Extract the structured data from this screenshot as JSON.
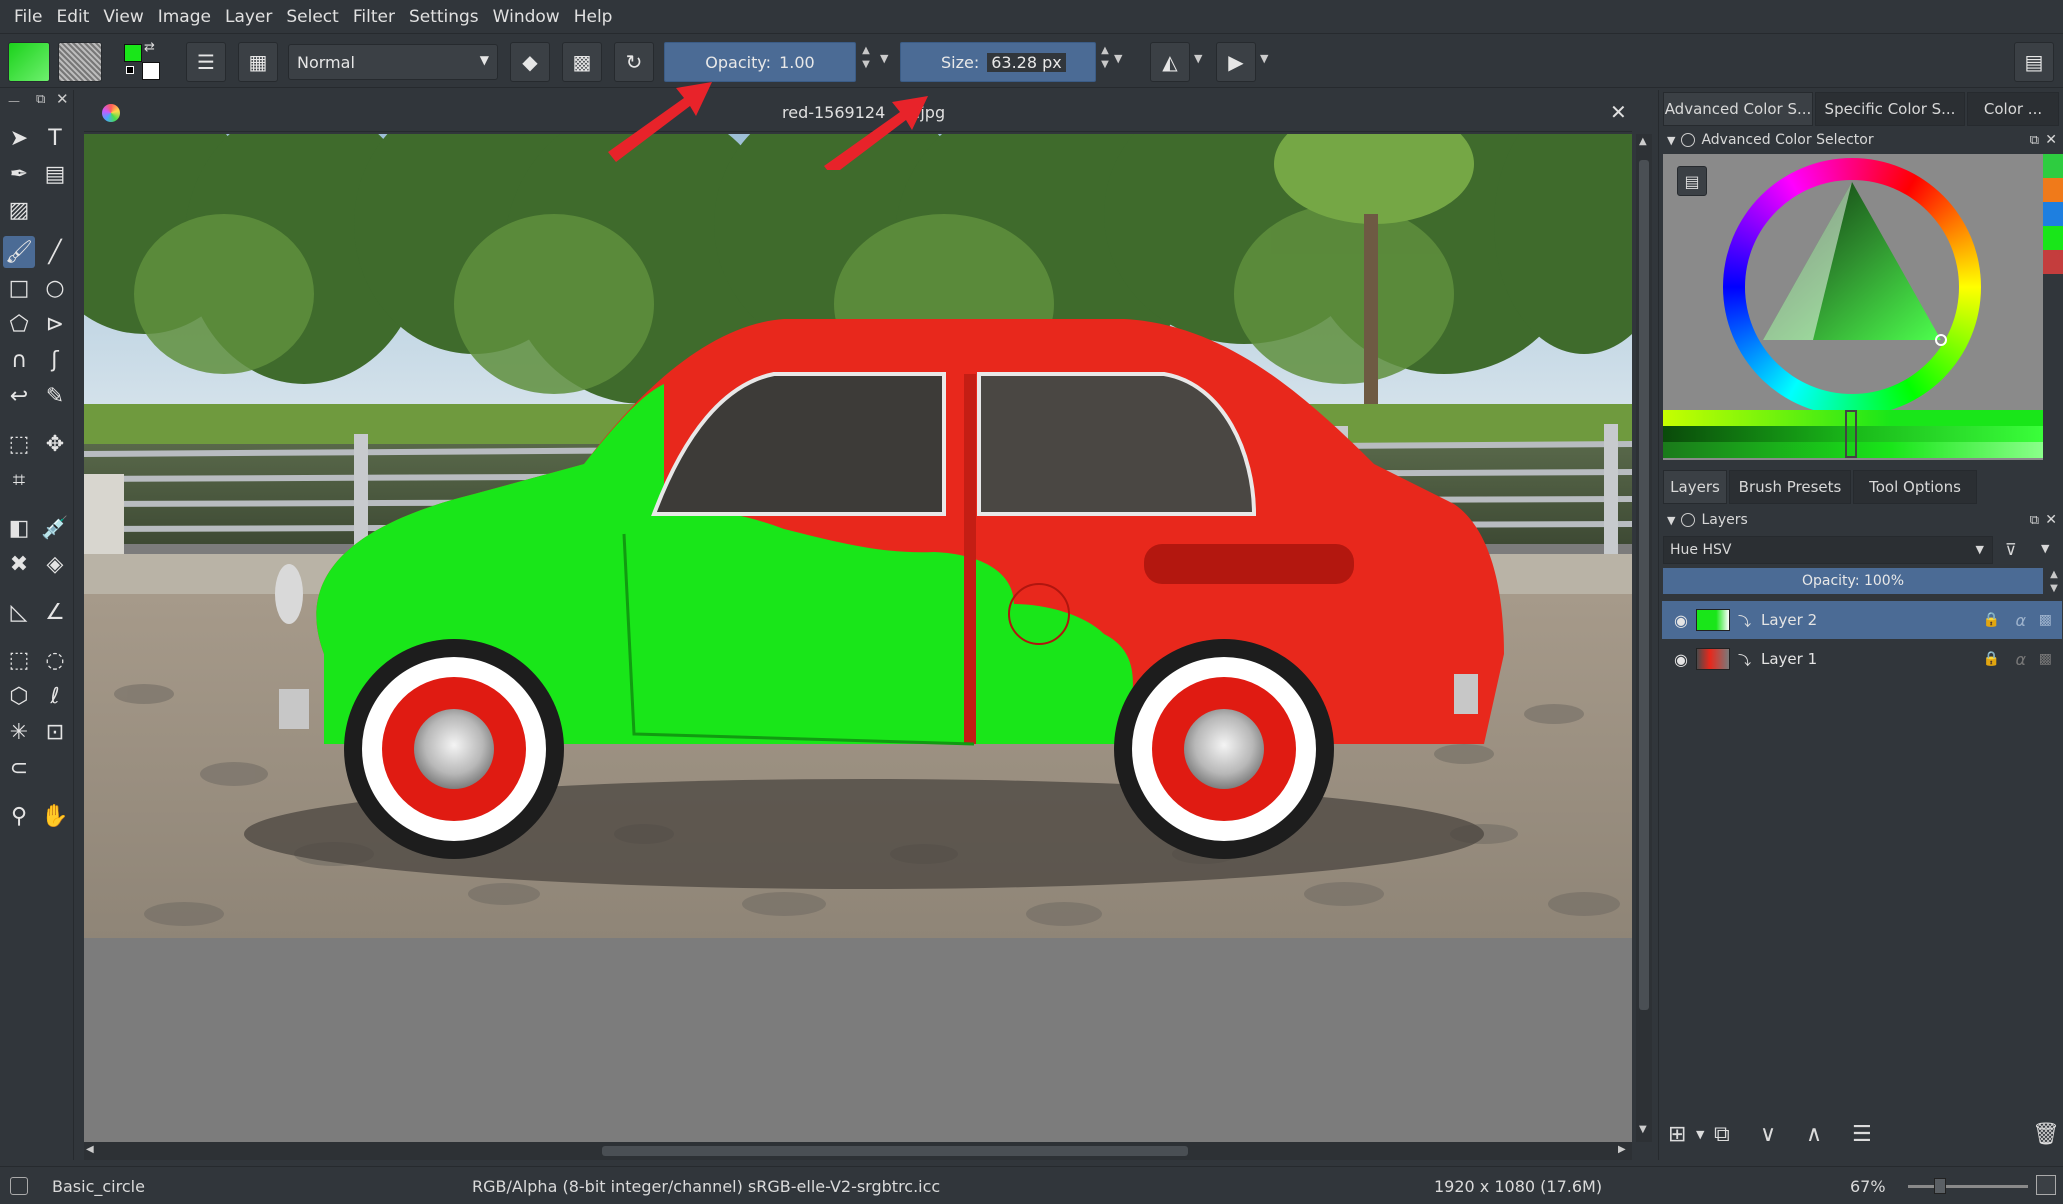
{
  "menu": [
    "File",
    "Edit",
    "View",
    "Image",
    "Layer",
    "Select",
    "Filter",
    "Settings",
    "Window",
    "Help"
  ],
  "toolbar": {
    "blend_mode": "Normal",
    "opacity_label": "Opacity:",
    "opacity_value": "1.00",
    "size_label": "Size:",
    "size_value": "63.28 px"
  },
  "document": {
    "title": "red-1569124",
    "title_ext": ".jpg"
  },
  "dock": {
    "top_tabs": [
      "Advanced Color S...",
      "Specific Color S...",
      "Color ..."
    ],
    "color_selector_title": "Advanced Color Selector",
    "bottom_tabs": [
      "Layers",
      "Brush Presets",
      "Tool Options"
    ],
    "layers_title": "Layers",
    "layer_blend_mode": "Hue HSV",
    "layer_opacity": "Opacity:  100%",
    "layers": [
      {
        "name": "Layer 2",
        "selected": true
      },
      {
        "name": "Layer 1",
        "selected": false
      }
    ]
  },
  "status": {
    "brush": "Basic_circle",
    "color_space": "RGB/Alpha (8-bit integer/channel)  sRGB-elle-V2-srgbtrc.icc",
    "dimensions": "1920 x 1080 (17.6M)",
    "zoom": "67%"
  },
  "colors": {
    "accent": "#4b6b95",
    "foreground_color": "#19e619",
    "background_color": "#ffffff",
    "annotation_arrow": "#e8232a"
  },
  "swatches": [
    "#2ecc40",
    "#f07a1a",
    "#1e7fe0",
    "#19e619",
    "#c43d3d"
  ]
}
